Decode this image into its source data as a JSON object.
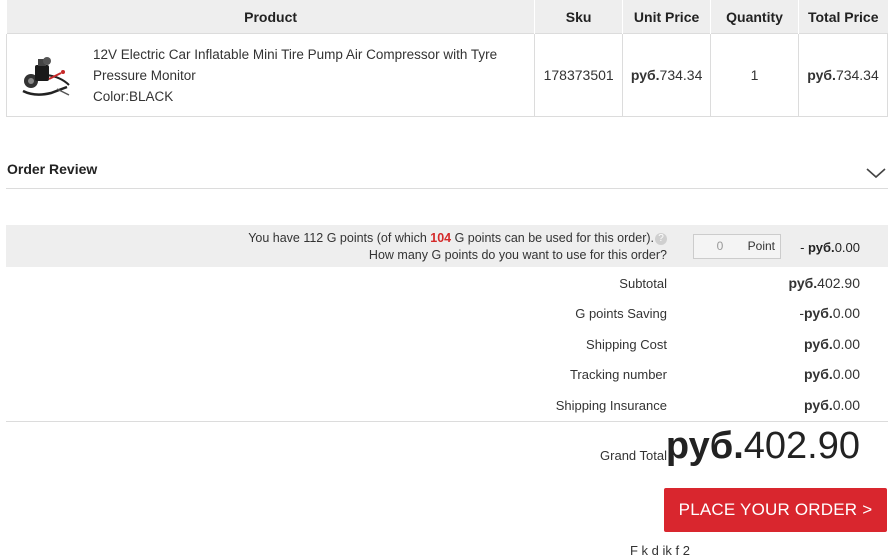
{
  "table": {
    "headers": [
      "Product",
      "Sku",
      "Unit Price",
      "Quantity",
      "Total Price"
    ],
    "item": {
      "name_line1": "12V Electric Car Inflatable Mini Tire Pump Air Compressor with Tyre",
      "name_line2": "Pressure Monitor",
      "color": "Color:BLACK",
      "sku": "178373501",
      "unit_price_currency": "руб.",
      "unit_price": "734.34",
      "quantity": "1",
      "total_currency": "руб.",
      "total": "734.34"
    }
  },
  "order_review": {
    "title": "Order Review"
  },
  "points": {
    "line1_prefix": "You have 112 G points (of which ",
    "usable": "104",
    "line1_suffix": " G points can be used for this order).",
    "help_icon": "?",
    "line2": "How many G points do you want to use for this order?",
    "input_value": "0",
    "unit": "Point",
    "discount_prefix": "- ",
    "discount_currency": "руб.",
    "discount": "0.00"
  },
  "summary": [
    {
      "label": "Subtotal",
      "prefix": "",
      "currency": "руб.",
      "value": "402.90"
    },
    {
      "label": "G points Saving",
      "prefix": "-",
      "currency": "руб.",
      "value": "0.00"
    },
    {
      "label": "Shipping Cost",
      "prefix": "",
      "currency": "руб.",
      "value": "0.00"
    },
    {
      "label": "Tracking number",
      "prefix": "",
      "currency": "руб.",
      "value": "0.00"
    },
    {
      "label": "Shipping Insurance",
      "prefix": "",
      "currency": "руб.",
      "value": "0.00"
    }
  ],
  "grand_total": {
    "label": "Grand Total",
    "currency": "руб.",
    "value": "402.90"
  },
  "place_order": {
    "label": "PLACE YOUR ORDER >"
  },
  "footer": {
    "partial_text": "F                  k        d    ik    f    2"
  },
  "colors": {
    "accent": "#d9262e",
    "header_bg": "#eeeeee",
    "highlight": "#d42a2a"
  }
}
